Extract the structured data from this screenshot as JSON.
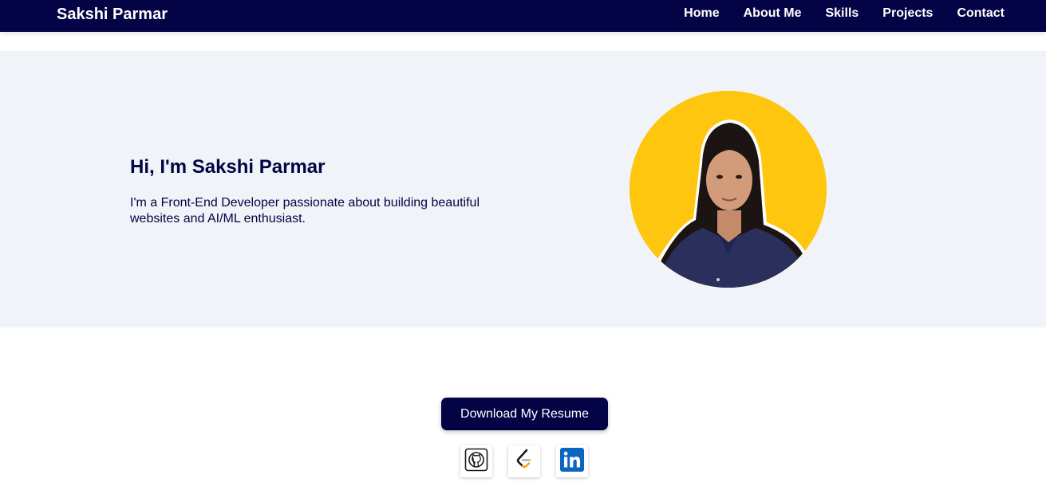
{
  "nav": {
    "brand": "Sakshi Parmar",
    "links": [
      "Home",
      "About Me",
      "Skills",
      "Projects",
      "Contact"
    ]
  },
  "hero": {
    "title": "Hi, I'm Sakshi Parmar",
    "description": "I'm a Front-End Developer passionate about building beautiful websites and AI/ML enthusiast."
  },
  "resume": {
    "label": "Download My Resume"
  },
  "socials": [
    {
      "icon": "github-icon"
    },
    {
      "icon": "leetcode-icon"
    },
    {
      "icon": "linkedin-icon"
    }
  ],
  "colors": {
    "navbar": "#030345",
    "hero_bg": "#f0f4f8",
    "portrait_bg": "#fec60e",
    "text_dark": "#030345",
    "linkedin": "#0a66c2",
    "leetcode_orange": "#ffa116"
  }
}
